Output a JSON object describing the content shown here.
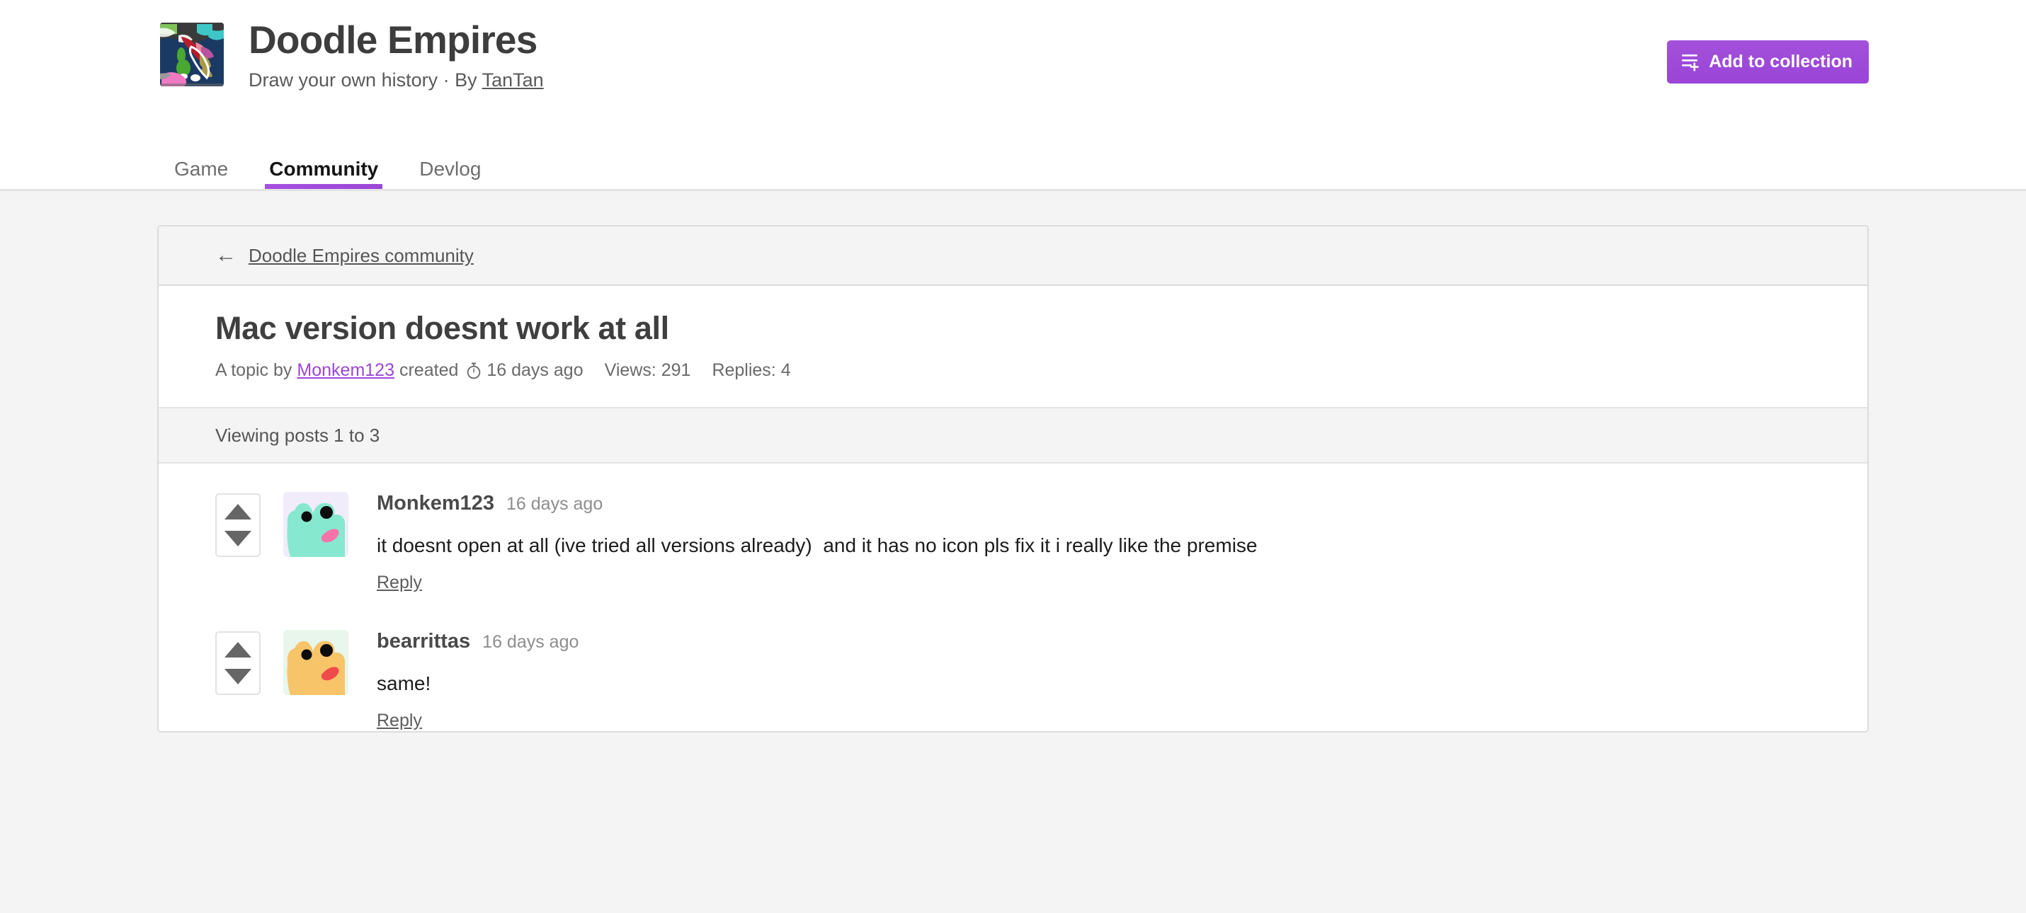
{
  "header": {
    "game_title": "Doodle Empires",
    "tagline_prefix": "Draw your own history · By ",
    "author": "TanTan",
    "add_collection_label": "Add to collection",
    "accent_color": "#9b47d6",
    "icon_name": "game-thumbnail-italy-map"
  },
  "tabs": [
    {
      "label": "Game",
      "active": false
    },
    {
      "label": "Community",
      "active": true
    },
    {
      "label": "Devlog",
      "active": false
    }
  ],
  "breadcrumb": {
    "arrow": "←",
    "label": "Doodle Empires community"
  },
  "topic": {
    "title": "Mac version doesnt work at all",
    "meta_prefix": "A topic by ",
    "author": "Monkem123",
    "meta_created": "created",
    "clock_icon": "stopwatch-icon",
    "created_ago": "16 days ago",
    "views_label": "Views: 291",
    "replies_label": "Replies: 4"
  },
  "viewing": {
    "label": "Viewing posts 1 to 3"
  },
  "posts": [
    {
      "author": "Monkem123",
      "time": "16 days ago",
      "text": "it doesnt open at all (ive tried all versions already)  and it has no icon pls fix it i really like the premise",
      "reply_label": "Reply",
      "avatar": {
        "name": "avatar-monkem123-mint-blob",
        "bg": "#f0ecf9",
        "body": "#86e8cf",
        "mouth": "#f972a8",
        "eye": "#0c0c0c"
      }
    },
    {
      "author": "bearrittas",
      "time": "16 days ago",
      "text": "same!",
      "reply_label": "Reply",
      "avatar": {
        "name": "avatar-bearrittas-orange-blob",
        "bg": "#e8f6ec",
        "body": "#f8c469",
        "mouth": "#ef4b4b",
        "eye": "#0c0c0c"
      }
    }
  ],
  "vote": {
    "up_icon": "upvote-arrow-icon",
    "down_icon": "downvote-arrow-icon"
  }
}
